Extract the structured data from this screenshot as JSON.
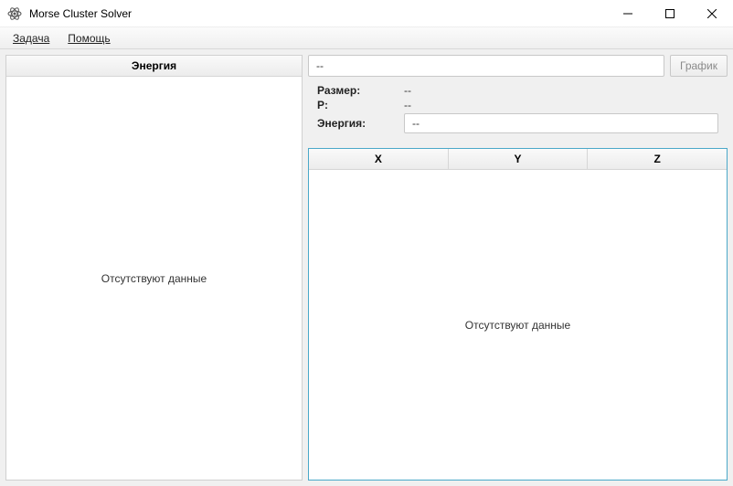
{
  "window": {
    "title": "Morse Cluster Solver"
  },
  "menu": {
    "task": "Задача",
    "help": "Помощь"
  },
  "left": {
    "header": "Энергия",
    "empty": "Отсутствуют данные"
  },
  "right": {
    "search_value": "--",
    "graph_button": "График",
    "size_label": "Размер:",
    "size_value": "--",
    "p_label": "P:",
    "p_value": "--",
    "energy_label": "Энергия:",
    "energy_value": "--",
    "columns": {
      "x": "X",
      "y": "Y",
      "z": "Z"
    },
    "empty": "Отсутствуют данные"
  }
}
